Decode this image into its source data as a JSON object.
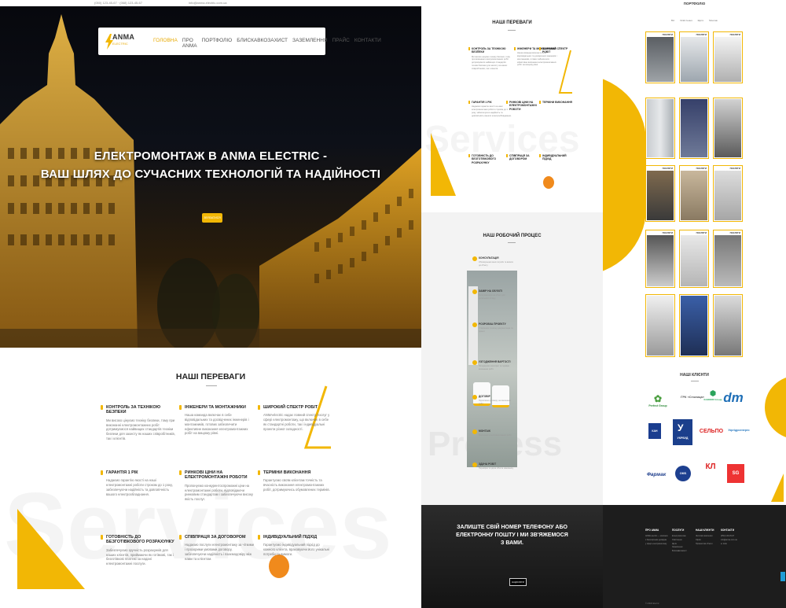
{
  "colors": {
    "accent": "#f2b705",
    "dark": "#1d1d1d"
  },
  "topbar": {
    "phones": "(050) 123-45-67 · (068) 123-45-67",
    "email": "info@anma.electric.com.ua"
  },
  "logo": {
    "title": "ANMA",
    "subtitle": "ELECTRIC"
  },
  "nav": {
    "items": [
      "ГОЛОВНА",
      "ПРО ANMA",
      "ПОРТФОЛІО",
      "БЛИСКАВКОЗАХИСТ",
      "ЗАЗЕМЛЕННЯ",
      "ПРАЙС",
      "КОНТАКТИ"
    ]
  },
  "hero": {
    "line1": "ЕЛЕКТРОМОНТАЖ В ANMA ELECTRIC -",
    "line2": "ВАШ ШЛЯХ ДО СУЧАСНИХ ТЕХНОЛОГІЙ ТА НАДІЙНОСТІ",
    "button": "ЗВ'ЯЗАТИСЯ"
  },
  "advantages": {
    "title": "НАШІ ПЕРЕВАГИ",
    "ghost": "Services",
    "items": [
      {
        "title": "КОНТРОЛЬ ЗА ТЕХНІКОЮ БЕЗПЕКИ",
        "text": "Ми високо цінуємо техніку безпеки, тому при виконанні електромонтажних робіт дотримуємося найвищих стандартів техніки безпеки для захисту як наших співробітників, так і клієнтів."
      },
      {
        "title": "ІНЖЕНЕРИ ТА МОНТАЖНИКИ",
        "text": "Наша команда включає в себе відповідальних та досвідчених інженерів і монтажників, готових забезпечити ефективне виконання електромонтажних робіт на вищому рівні."
      },
      {
        "title": "ШИРОКИЙ СПЕКТР РОБІТ",
        "text": "ANMAelectric надає повний спектр послуг у сфері електромонтажу, що включає в себе як стандартні роботи, так і індивідуальні проекти різної складності."
      },
      {
        "title": "ГАРАНТІЯ 1 РІК",
        "text": "Надаємо гарантію якості на наші електромонтажні роботи строком до 1 року, забезпечуючи надійність та довговічність вашого електрообладнання."
      },
      {
        "title": "РИНКОВІ ЦІНИ НА ЕЛЕКТРОМОНТАЖНІ РОБОТИ",
        "text": "Пропонуємо конкурентоспроможні ціни на електромонтажні роботи, відповідаючи ринковим стандартам і забезпечуючи високу якість послуг."
      },
      {
        "title": "ТЕРМІНИ ВИКОНАННЯ",
        "text": "Гарантуємо своїм клієнтам точність та вчасність виконання електромонтажних робіт, дотримуючись обумовлених термінів."
      },
      {
        "title": "ГОТОВНІСТЬ ДО БЕЗГОТІВКОВОГО РОЗРАХУНКУ",
        "text": "Забезпечуємо зручність розрахунків для наших клієнтів, приймаючи як готівкові, так і безготівкові платежі за надані електромонтажні послуги."
      },
      {
        "title": "СПІВПРАЦЯ ЗА ДОГОВОРОМ",
        "text": "Надаємо послуги електромонтажу за чіткими і прозорими умовами договору, забезпечуючи надійність і взаємодовіру між нами та клієнтом."
      },
      {
        "title": "ІНДИВІДУАЛЬНИЙ ПІДХІД",
        "text": "Гарантуємо індивідуальний підхід до кожного клієнта, враховуючи його унікальні потреби та вимоги."
      }
    ]
  },
  "process": {
    "title": "НАШ РОБОЧИЙ ПРОЦЕС",
    "ghost": "Process",
    "steps": [
      {
        "title": "КОНСУЛЬТАЦІЯ",
        "text": "Обговорюємо ваші потреби та вимоги до об'єкту."
      },
      {
        "title": "ЗАМІР НА ОБ'ЄКТІ",
        "text": "Виїзд інженера на об'єкт для детального огляду."
      },
      {
        "title": "РОЗРОБКА ПРОЕКТУ",
        "text": "Створюємо технічну документацію та проект."
      },
      {
        "title": "УЗГОДЖЕННЯ ВАРТОСТІ",
        "text": "Погоджуємо кошторис та терміни виконання робіт."
      },
      {
        "title": "ДОГОВІР",
        "text": "Підписання договору на виконання робіт."
      },
      {
        "title": "МОНТАЖ",
        "text": "Виконання електромонтажних робіт."
      },
      {
        "title": "ЗДАЧА РОБІТ",
        "text": "Перевірка та здача об'єкта замовнику."
      }
    ]
  },
  "cta": {
    "line1": "ЗАЛИШТЕ СВІЙ НОМЕР ТЕЛЕФОНУ АБО",
    "line2": "ЕЛЕКТРОННУ ПОШТУ І МИ ЗВ'ЯЖЕМОСЯ",
    "line3": "З ВАМИ.",
    "button": "НАДІСЛАТИ"
  },
  "portfolio": {
    "title": "ПОРТФОЛІО",
    "filters": [
      "Всі",
      "Освітлення",
      "Щити",
      "Монтаж"
    ],
    "card_label": "ПОСЛУГИ"
  },
  "clients": {
    "title": "НАШІ КЛІЄНТИ",
    "logos": [
      "Perfect Group",
      "ГРК «Столица»",
      "KADORR Group",
      "dm",
      "КАН",
      "УКРБУД",
      "СЕЛЬПО",
      "Укргідроенерго",
      "Фармак",
      "ОКБ",
      "КЛ",
      "SG"
    ]
  },
  "footer": {
    "cols": [
      {
        "title": "ПРО ANMA",
        "links": [
          "ANMA electric — компанія",
          "з багаторічним досвідом",
          "у сфері електромонтажу."
        ]
      },
      {
        "title": "ПОСЛУГИ",
        "links": [
          "Електромонтаж",
          "Освітлення",
          "Щити",
          "Заземлення",
          "Блискавкозахист"
        ]
      },
      {
        "title": "НАШІ КЛІЄНТИ",
        "links": [
          "Житлові комплекси",
          "Офіси",
          "Промислові об'єкти"
        ]
      },
      {
        "title": "КОНТАКТИ",
        "links": [
          "(050) 123-45-67",
          "info@anma.com.ua",
          "м. Київ"
        ]
      }
    ],
    "copyright": "© ANMA Electric"
  }
}
